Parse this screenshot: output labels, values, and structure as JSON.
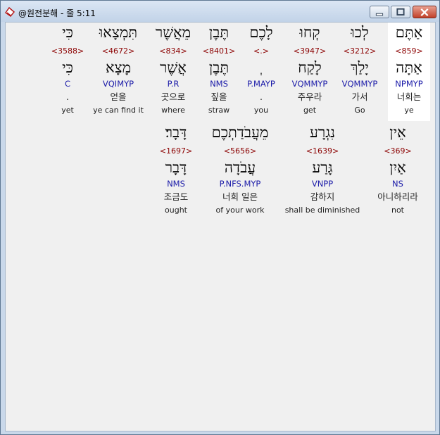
{
  "window": {
    "title": "@원전분해 - 줄 5:11",
    "buttons": {
      "minimize": "minimize-icon",
      "maximize": "maximize-icon",
      "close": "close-icon"
    }
  },
  "rows": [
    {
      "words": [
        {
          "heb": "אַתֶּם",
          "strong": "<859>",
          "lemma": "אַתָּה",
          "parse": "NPMYP",
          "kor": "너희는",
          "eng": "ye",
          "selected": true
        },
        {
          "heb": "לְכוּ",
          "strong": "<3212>",
          "lemma": "יָלַךְ",
          "parse": "VQMMYP",
          "kor": "가서",
          "eng": "Go",
          "selected": false
        },
        {
          "heb": "קְחוּ",
          "strong": "<3947>",
          "lemma": "לָקַח",
          "parse": "VQMMYP",
          "kor": "주우라",
          "eng": "get",
          "selected": false
        },
        {
          "heb": "לָכֶם",
          "strong": "<.>",
          "lemma": "ְ",
          "parse": "P.MAYP",
          "kor": ".",
          "eng": "you",
          "selected": false
        },
        {
          "heb": "תֶּבֶן",
          "strong": "<8401>",
          "lemma": "תֶּבֶן",
          "parse": "NMS",
          "kor": "짚을",
          "eng": "straw",
          "selected": false
        },
        {
          "heb": "מֵאֲשֶׁר",
          "strong": "<834>",
          "lemma": "אֲשֶׁר",
          "parse": "P.R",
          "kor": "곳으로",
          "eng": "where",
          "selected": false
        },
        {
          "heb": "תִּמְצָאוּ",
          "strong": "<4672>",
          "lemma": "מָצָא",
          "parse": "VQIMYP",
          "kor": "얻을",
          "eng": "ye can find it",
          "selected": false
        },
        {
          "heb": "כִּי",
          "strong": "<3588>",
          "lemma": "כִּי",
          "parse": "C",
          "kor": ".",
          "eng": "yet",
          "selected": false
        }
      ]
    },
    {
      "words": [
        {
          "heb": "אֵין",
          "strong": "<369>",
          "lemma": "אַיִן",
          "parse": "NS",
          "kor": "아니하리라",
          "eng": "not",
          "selected": false
        },
        {
          "heb": "נִגְרָע",
          "strong": "<1639>",
          "lemma": "גָּרַע",
          "parse": "VNPP",
          "kor": "감하지",
          "eng": "shall be diminished",
          "selected": false
        },
        {
          "heb": "מֵעֲבֹדַתְכֶם",
          "strong": "<5656>",
          "lemma": "עֲבֹדָה",
          "parse": "P.NFS.MYP",
          "kor": "너희 일은",
          "eng": "of your work",
          "selected": false
        },
        {
          "heb": "דָּבָר׃",
          "strong": "<1697>",
          "lemma": "דָּבָר",
          "parse": "NMS",
          "kor": "조금도",
          "eng": "ought",
          "selected": false
        }
      ]
    }
  ]
}
